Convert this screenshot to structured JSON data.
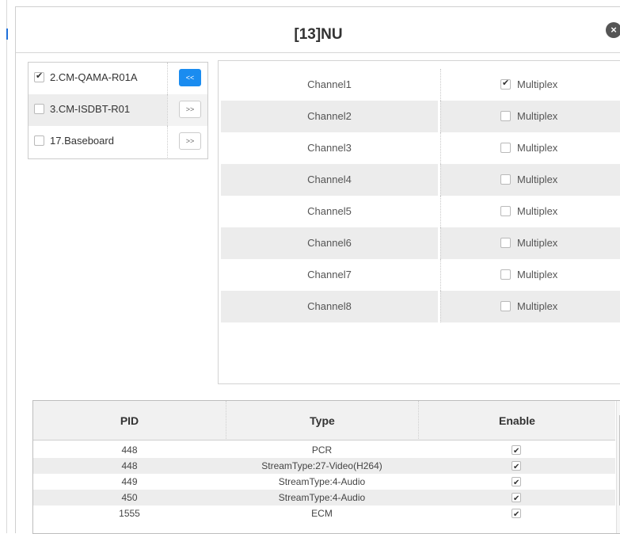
{
  "dialog": {
    "title": "[13]NU",
    "close_icon": "close-icon",
    "close_glyph": "×"
  },
  "boards": [
    {
      "label": "2.CM-QAMA-R01A",
      "checked": true,
      "button": "<<",
      "active": true
    },
    {
      "label": "3.CM-ISDBT-R01",
      "checked": false,
      "button": ">>",
      "active": false
    },
    {
      "label": "17.Baseboard",
      "checked": false,
      "button": ">>",
      "active": false
    }
  ],
  "channels": [
    {
      "name": "Channel1",
      "mux_label": "Multiplex",
      "checked": true
    },
    {
      "name": "Channel2",
      "mux_label": "Multiplex",
      "checked": false
    },
    {
      "name": "Channel3",
      "mux_label": "Multiplex",
      "checked": false
    },
    {
      "name": "Channel4",
      "mux_label": "Multiplex",
      "checked": false
    },
    {
      "name": "Channel5",
      "mux_label": "Multiplex",
      "checked": false
    },
    {
      "name": "Channel6",
      "mux_label": "Multiplex",
      "checked": false
    },
    {
      "name": "Channel7",
      "mux_label": "Multiplex",
      "checked": false
    },
    {
      "name": "Channel8",
      "mux_label": "Multiplex",
      "checked": false
    }
  ],
  "pid_table": {
    "headers": [
      "PID",
      "Type",
      "Enable"
    ],
    "rows": [
      {
        "pid": "448",
        "type": "PCR",
        "enabled": true
      },
      {
        "pid": "448",
        "type": "StreamType:27-Video(H264)",
        "enabled": true
      },
      {
        "pid": "449",
        "type": "StreamType:4-Audio",
        "enabled": true
      },
      {
        "pid": "450",
        "type": "StreamType:4-Audio",
        "enabled": true
      },
      {
        "pid": "1555",
        "type": "ECM",
        "enabled": true
      }
    ]
  },
  "colors": {
    "accent": "#1a8cf0",
    "row_alt": "#ececec",
    "close_bg": "#555555"
  }
}
